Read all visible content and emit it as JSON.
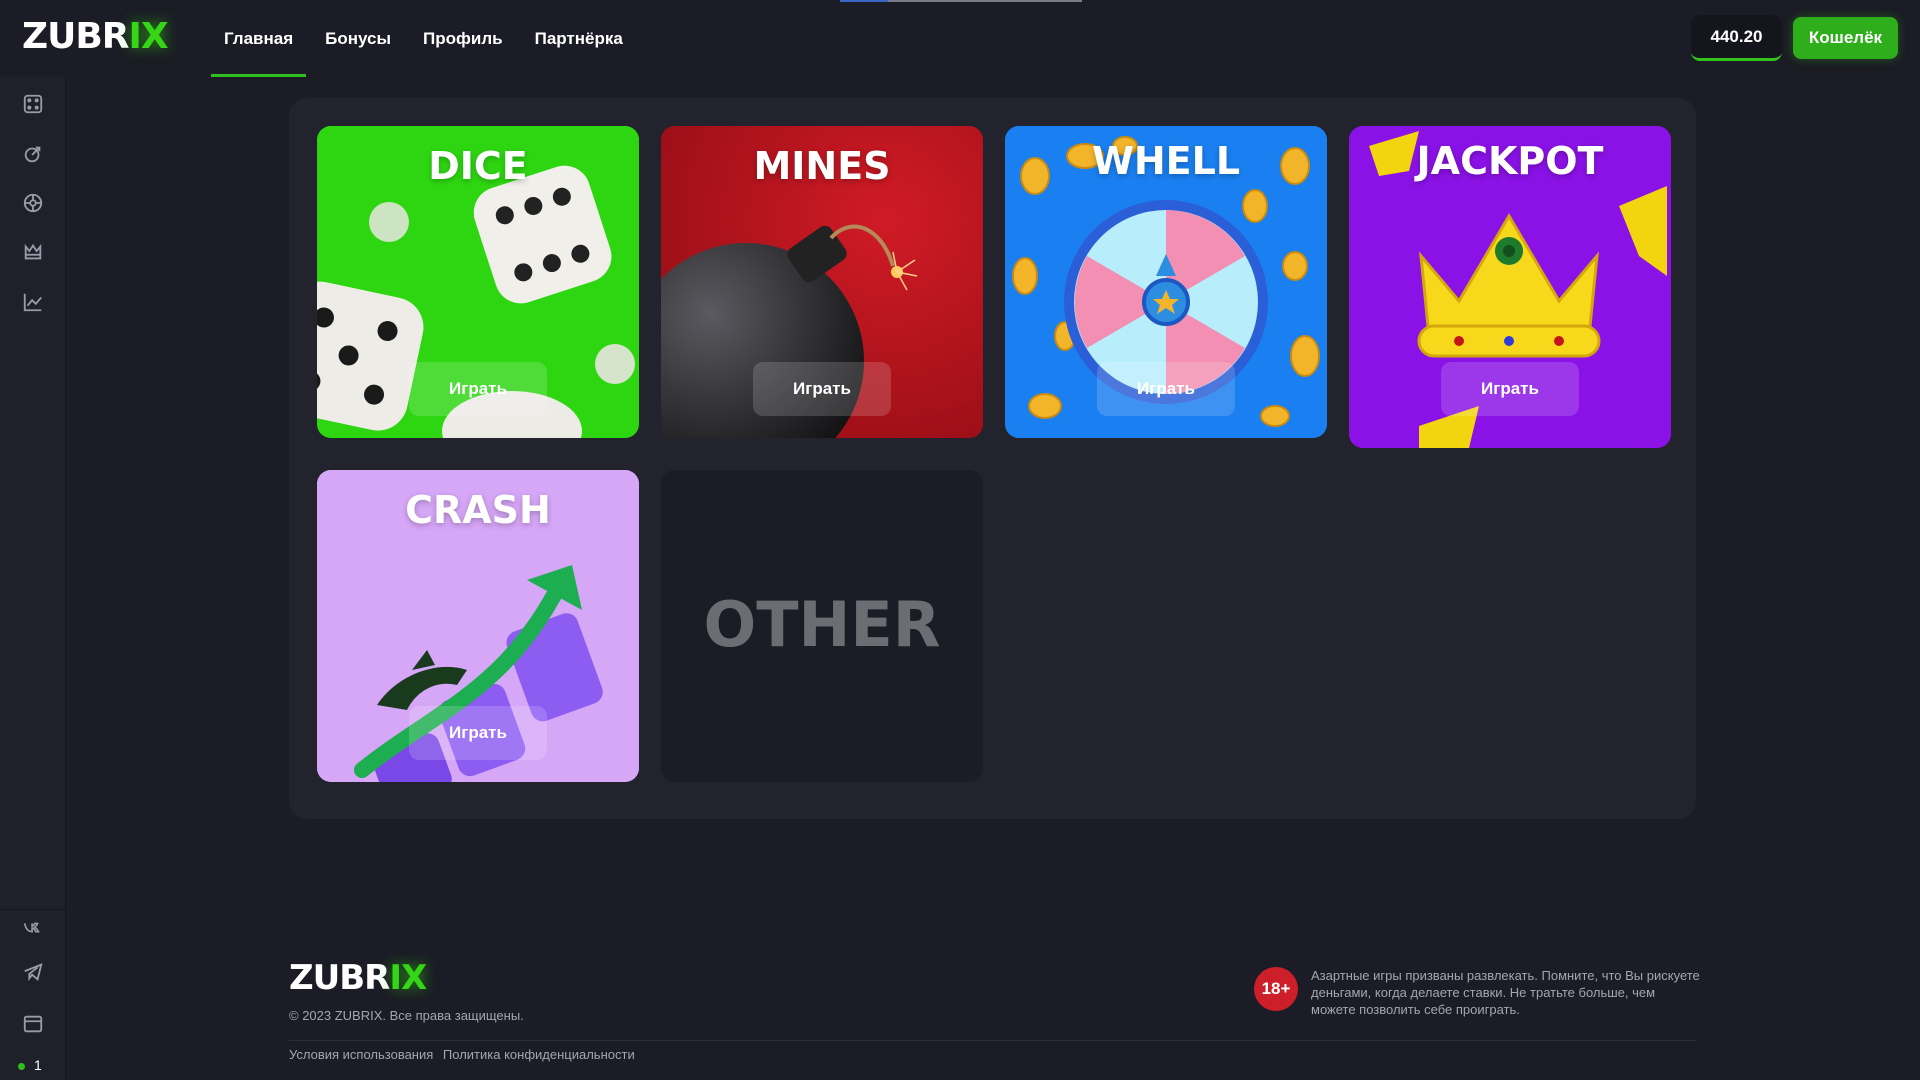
{
  "app": {
    "logo_main": "ZUBR",
    "logo_accent": "IX"
  },
  "nav": {
    "items": [
      {
        "label": "Главная",
        "active": true
      },
      {
        "label": "Бонусы"
      },
      {
        "label": "Профиль"
      },
      {
        "label": "Партнёрка"
      }
    ]
  },
  "header": {
    "balance": "440.20",
    "wallet_label": "Кошелёк"
  },
  "sidebar": {
    "icons": [
      "dice-icon",
      "spin-icon",
      "wheel-icon",
      "crown-icon",
      "chart-icon"
    ],
    "social": [
      "vk-icon",
      "telegram-icon",
      "window-icon"
    ],
    "online_count": "1"
  },
  "games": [
    {
      "title": "DICE",
      "play": "Играть",
      "bg": "#2ed612"
    },
    {
      "title": "MINES",
      "play": "Играть",
      "bg": "#c41620"
    },
    {
      "title": "WHELL",
      "play": "Играть",
      "bg": "#1a7ff0"
    },
    {
      "title": "JACKPOT",
      "play": "Играть",
      "bg": "#8a12e6"
    },
    {
      "title": "CRASH",
      "play": "Играть",
      "bg": "#d6a6f7"
    },
    {
      "title": "OTHER",
      "bg": "#1b1c25"
    }
  ],
  "footer": {
    "logo_main": "ZUBR",
    "logo_accent": "IX",
    "copyright": "© 2023 ZUBRIX. Все права защищены.",
    "links": [
      "Условия использования",
      "Политика конфиденциальности"
    ],
    "age": "18+",
    "warning": "Азартные игры призваны развлекать. Помните, что Вы рискуете деньгами, когда делаете ставки. Не тратьте больше, чем можете позволить себе проиграть."
  },
  "colors": {
    "accent": "#2fbf1e",
    "bg": "#1b1c25",
    "panel": "#22232d"
  }
}
